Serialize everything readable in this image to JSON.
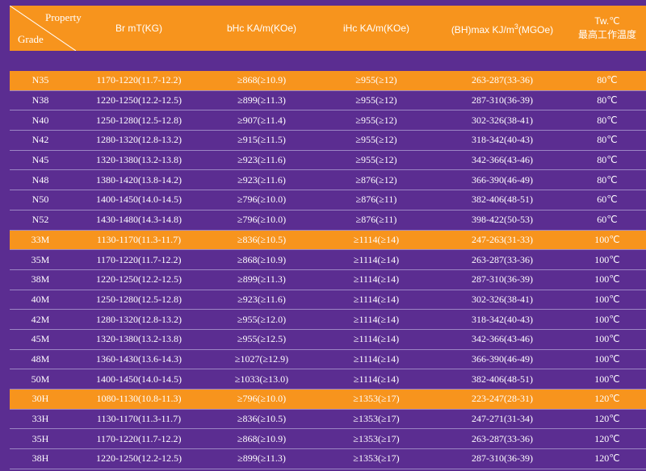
{
  "header": {
    "property_label": "Property",
    "grade_label": "Grade",
    "columns": {
      "br": "Br mT(KG)",
      "bhc": "bHc KA/m(KOe)",
      "ihc": "iHc KA/m(KOe)",
      "bhmax_main": "(BH)max KJ/m",
      "bhmax_sup": "3",
      "bhmax_tail": "(MGOe)",
      "tw": "Tw.℃",
      "tw_sub": "最高工作温度"
    }
  },
  "rows": [
    {
      "grade": "N35",
      "br": "1170-1220(11.7-12.2)",
      "bhc": "≥868(≥10.9)",
      "ihc": "≥955(≥12)",
      "bhmax": "263-287(33-36)",
      "tw": "80℃",
      "highlight": true
    },
    {
      "grade": "N38",
      "br": "1220-1250(12.2-12.5)",
      "bhc": "≥899(≥11.3)",
      "ihc": "≥955(≥12)",
      "bhmax": "287-310(36-39)",
      "tw": "80℃",
      "highlight": false
    },
    {
      "grade": "N40",
      "br": "1250-1280(12.5-12.8)",
      "bhc": "≥907(≥11.4)",
      "ihc": "≥955(≥12)",
      "bhmax": "302-326(38-41)",
      "tw": "80℃",
      "highlight": false
    },
    {
      "grade": "N42",
      "br": "1280-1320(12.8-13.2)",
      "bhc": "≥915(≥11.5)",
      "ihc": "≥955(≥12)",
      "bhmax": "318-342(40-43)",
      "tw": "80℃",
      "highlight": false
    },
    {
      "grade": "N45",
      "br": "1320-1380(13.2-13.8)",
      "bhc": "≥923(≥11.6)",
      "ihc": "≥955(≥12)",
      "bhmax": "342-366(43-46)",
      "tw": "80℃",
      "highlight": false
    },
    {
      "grade": "N48",
      "br": "1380-1420(13.8-14.2)",
      "bhc": "≥923(≥11.6)",
      "ihc": "≥876(≥12)",
      "bhmax": "366-390(46-49)",
      "tw": "80℃",
      "highlight": false
    },
    {
      "grade": "N50",
      "br": "1400-1450(14.0-14.5)",
      "bhc": "≥796(≥10.0)",
      "ihc": "≥876(≥11)",
      "bhmax": "382-406(48-51)",
      "tw": "60℃",
      "highlight": false
    },
    {
      "grade": "N52",
      "br": "1430-1480(14.3-14.8)",
      "bhc": "≥796(≥10.0)",
      "ihc": "≥876(≥11)",
      "bhmax": "398-422(50-53)",
      "tw": "60℃",
      "highlight": false
    },
    {
      "grade": "33M",
      "br": "1130-1170(11.3-11.7)",
      "bhc": "≥836(≥10.5)",
      "ihc": "≥1114(≥14)",
      "bhmax": "247-263(31-33)",
      "tw": "100℃",
      "highlight": true
    },
    {
      "grade": "35M",
      "br": "1170-1220(11.7-12.2)",
      "bhc": "≥868(≥10.9)",
      "ihc": "≥1114(≥14)",
      "bhmax": "263-287(33-36)",
      "tw": "100℃",
      "highlight": false
    },
    {
      "grade": "38M",
      "br": "1220-1250(12.2-12.5)",
      "bhc": "≥899(≥11.3)",
      "ihc": "≥1114(≥14)",
      "bhmax": "287-310(36-39)",
      "tw": "100℃",
      "highlight": false
    },
    {
      "grade": "40M",
      "br": "1250-1280(12.5-12.8)",
      "bhc": "≥923(≥11.6)",
      "ihc": "≥1114(≥14)",
      "bhmax": "302-326(38-41)",
      "tw": "100℃",
      "highlight": false
    },
    {
      "grade": "42M",
      "br": "1280-1320(12.8-13.2)",
      "bhc": "≥955(≥12.0)",
      "ihc": "≥1114(≥14)",
      "bhmax": "318-342(40-43)",
      "tw": "100℃",
      "highlight": false
    },
    {
      "grade": "45M",
      "br": "1320-1380(13.2-13.8)",
      "bhc": "≥955(≥12.5)",
      "ihc": "≥1114(≥14)",
      "bhmax": "342-366(43-46)",
      "tw": "100℃",
      "highlight": false
    },
    {
      "grade": "48M",
      "br": "1360-1430(13.6-14.3)",
      "bhc": "≥1027(≥12.9)",
      "ihc": "≥1114(≥14)",
      "bhmax": "366-390(46-49)",
      "tw": "100℃",
      "highlight": false
    },
    {
      "grade": "50M",
      "br": "1400-1450(14.0-14.5)",
      "bhc": "≥1033(≥13.0)",
      "ihc": "≥1114(≥14)",
      "bhmax": "382-406(48-51)",
      "tw": "100℃",
      "highlight": false
    },
    {
      "grade": "30H",
      "br": "1080-1130(10.8-11.3)",
      "bhc": "≥796(≥10.0)",
      "ihc": "≥1353(≥17)",
      "bhmax": "223-247(28-31)",
      "tw": "120℃",
      "highlight": true
    },
    {
      "grade": "33H",
      "br": "1130-1170(11.3-11.7)",
      "bhc": "≥836(≥10.5)",
      "ihc": "≥1353(≥17)",
      "bhmax": "247-271(31-34)",
      "tw": "120℃",
      "highlight": false
    },
    {
      "grade": "35H",
      "br": "1170-1220(11.7-12.2)",
      "bhc": "≥868(≥10.9)",
      "ihc": "≥1353(≥17)",
      "bhmax": "263-287(33-36)",
      "tw": "120℃",
      "highlight": false
    },
    {
      "grade": "38H",
      "br": "1220-1250(12.2-12.5)",
      "bhc": "≥899(≥11.3)",
      "ihc": "≥1353(≥17)",
      "bhmax": "287-310(36-39)",
      "tw": "120℃",
      "highlight": false
    }
  ],
  "colors": {
    "background": "#5b2d91",
    "highlight": "#f7941d",
    "text": "#ffffff",
    "divider": "#9c86c4"
  }
}
